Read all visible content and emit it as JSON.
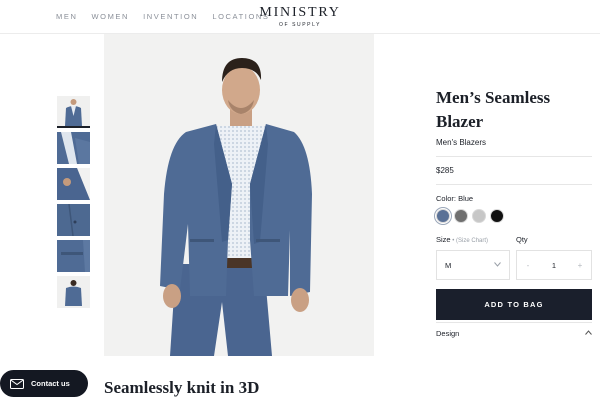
{
  "nav": {
    "items": [
      "MEN",
      "WOMEN",
      "INVENTION",
      "LOCATIONS"
    ]
  },
  "logo": {
    "main": "MINISTRY",
    "sub": "OF SUPPLY"
  },
  "product": {
    "title": "Men’s Seamless Blazer",
    "category": "Men's Blazers",
    "price": "$285",
    "color_label": "Color: Blue",
    "colors": [
      {
        "name": "Blue",
        "hex": "#5a7196"
      },
      {
        "name": "Charcoal",
        "hex": "#6f6f6f"
      },
      {
        "name": "Light Grey",
        "hex": "#c7c7c7"
      },
      {
        "name": "Black",
        "hex": "#111111"
      }
    ],
    "selected_color_index": 0,
    "size_label": "Size",
    "size_separator": " • ",
    "size_chart_label": "(Size Chart)",
    "size_value": "M",
    "qty_label": "Qty",
    "qty_value": "1",
    "qty_minus": "-",
    "qty_plus": "+",
    "add_to_bag_label": "ADD TO BAG",
    "design_label": "Design"
  },
  "section": {
    "heading": "Seamlessly knit in 3D"
  },
  "contact": {
    "label": "Contact us"
  },
  "icons": {
    "chevron_down": "chevron-down-icon",
    "chevron_up": "chevron-up-icon",
    "mail": "mail-icon"
  },
  "colors": {
    "dark": "#1a1f2c",
    "nav_text": "#8a8f98",
    "blazer": "#4f6b95"
  }
}
